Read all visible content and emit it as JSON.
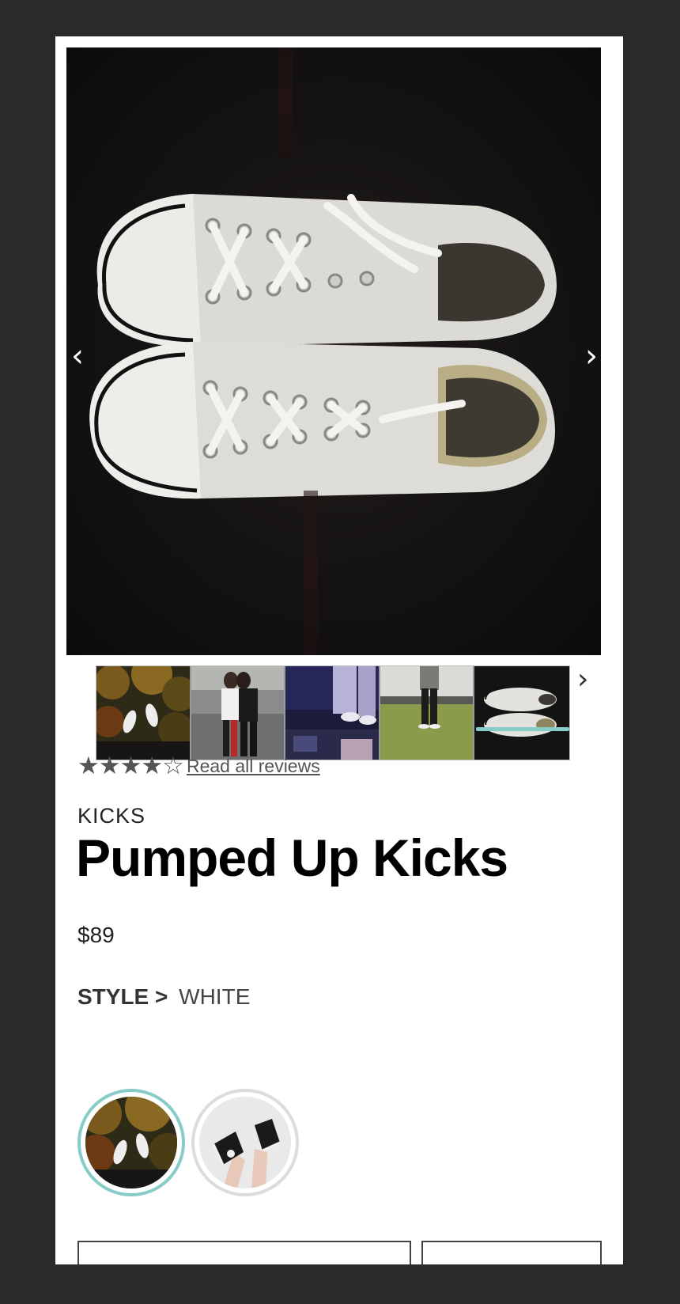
{
  "gallery": {
    "main_image": "white-low-top-sneakers-pair",
    "prev_icon": "chevron-left-icon",
    "next_icon": "chevron-right-icon",
    "prev_glyph": "‹",
    "next_glyph": "›",
    "thumbnails": [
      {
        "name": "sneakers-in-autumn-leaves"
      },
      {
        "name": "two-friends-posing"
      },
      {
        "name": "concert-stage-feet"
      },
      {
        "name": "person-standing-on-grass"
      },
      {
        "name": "white-sneakers-pair",
        "active": true
      }
    ]
  },
  "rating": {
    "stars": "★★★★☆",
    "value": 4,
    "max": 5,
    "reviews_link": "Read all reviews"
  },
  "product": {
    "brand": "KICKS",
    "title": "Pumped Up Kicks",
    "price": "$89"
  },
  "style": {
    "label": "STYLE",
    "separator": ">",
    "value": "WHITE",
    "swatches": [
      {
        "name": "white-sneakers-autumn",
        "selected": true
      },
      {
        "name": "black-high-top-sneakers",
        "selected": false
      }
    ]
  },
  "colors": {
    "accent": "#88ccc8",
    "background": "#2a2a2a",
    "card": "#ffffff"
  }
}
